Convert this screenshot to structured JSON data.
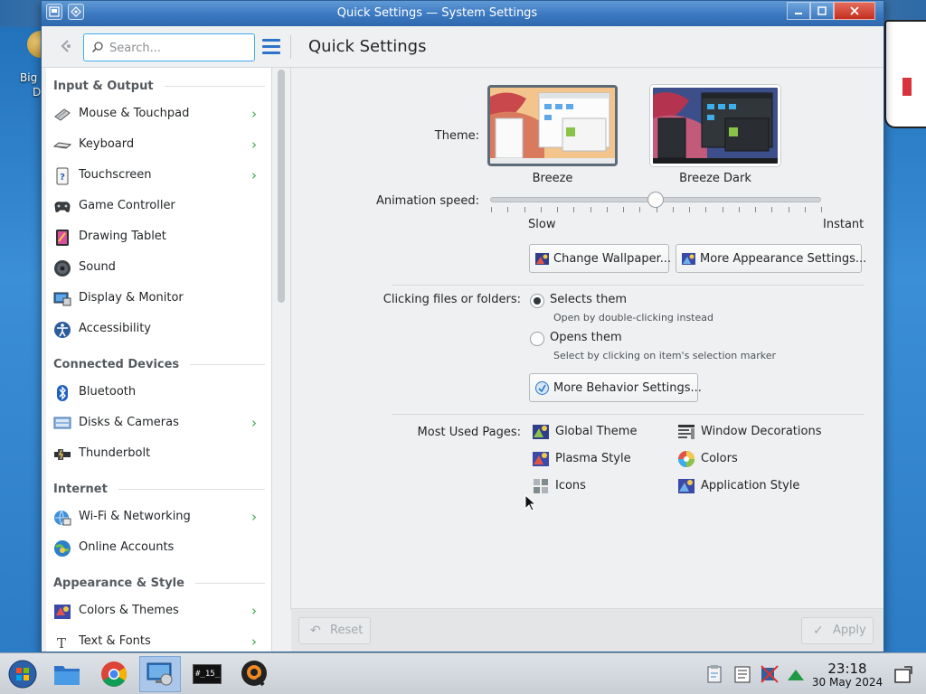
{
  "window": {
    "title": "Quick Settings — System Settings"
  },
  "header": {
    "search_placeholder": "Search...",
    "page_title": "Quick Settings"
  },
  "desktop": {
    "icon_label_1": "Big",
    "icon_label_2": "D"
  },
  "sidebar": {
    "categories": [
      "Input & Output",
      "Connected Devices",
      "Internet",
      "Appearance & Style"
    ],
    "items": [
      {
        "label": "Mouse & Touchpad",
        "icon": "mouse-icon",
        "chevron": true
      },
      {
        "label": "Keyboard",
        "icon": "keyboard-icon",
        "chevron": true
      },
      {
        "label": "Touchscreen",
        "icon": "touchscreen-icon",
        "chevron": true
      },
      {
        "label": "Game Controller",
        "icon": "game-controller-icon",
        "chevron": false
      },
      {
        "label": "Drawing Tablet",
        "icon": "drawing-tablet-icon",
        "chevron": false
      },
      {
        "label": "Sound",
        "icon": "speaker-icon",
        "chevron": false
      },
      {
        "label": "Display & Monitor",
        "icon": "monitor-icon",
        "chevron": false
      },
      {
        "label": "Accessibility",
        "icon": "accessibility-icon",
        "chevron": false
      },
      {
        "label": "Bluetooth",
        "icon": "bluetooth-icon",
        "chevron": false
      },
      {
        "label": "Disks & Cameras",
        "icon": "disks-icon",
        "chevron": true
      },
      {
        "label": "Thunderbolt",
        "icon": "thunderbolt-icon",
        "chevron": false
      },
      {
        "label": "Wi-Fi & Networking",
        "icon": "network-icon",
        "chevron": true
      },
      {
        "label": "Online Accounts",
        "icon": "online-accounts-icon",
        "chevron": false
      },
      {
        "label": "Colors & Themes",
        "icon": "colors-themes-icon",
        "chevron": true
      },
      {
        "label": "Text & Fonts",
        "icon": "fonts-icon",
        "chevron": true
      }
    ]
  },
  "content": {
    "theme_label": "Theme:",
    "themes": [
      {
        "name": "Breeze",
        "selected": true
      },
      {
        "name": "Breeze Dark",
        "selected": false
      }
    ],
    "animation_label": "Animation speed:",
    "animation_slow": "Slow",
    "animation_instant": "Instant",
    "animation_level": 0.5,
    "change_wallpaper": "Change Wallpaper...",
    "more_appearance": "More Appearance Settings...",
    "clicking_label": "Clicking files or folders:",
    "option_select": "Selects them",
    "option_select_sub": "Open by double-clicking instead",
    "option_open": "Opens them",
    "option_open_sub": "Select by clicking on item's selection marker",
    "selected_option": "select",
    "more_behavior": "More Behavior Settings...",
    "most_used_label": "Most Used Pages:",
    "most_used": [
      {
        "label": "Global Theme",
        "icon": "global-theme-icon"
      },
      {
        "label": "Window Decorations",
        "icon": "window-decorations-icon"
      },
      {
        "label": "Plasma Style",
        "icon": "plasma-style-icon"
      },
      {
        "label": "Colors",
        "icon": "colors-icon"
      },
      {
        "label": "Icons",
        "icon": "icons-icon"
      },
      {
        "label": "Application Style",
        "icon": "application-style-icon"
      }
    ]
  },
  "footer": {
    "reset": "Reset",
    "apply": "Apply"
  },
  "taskbar": {
    "apps": [
      "start-menu-icon",
      "file-manager-icon",
      "chrome-icon",
      "system-settings-icon",
      "terminal-icon",
      "quassel-icon"
    ],
    "terminal_text": "#_15_",
    "time": "23:18",
    "date": "30 May 2024"
  },
  "colors": {
    "accent": "#3daee9",
    "titlebar": "#3b78c0",
    "chevron": "#3aa14a",
    "window_bg": "#eff0f1"
  }
}
